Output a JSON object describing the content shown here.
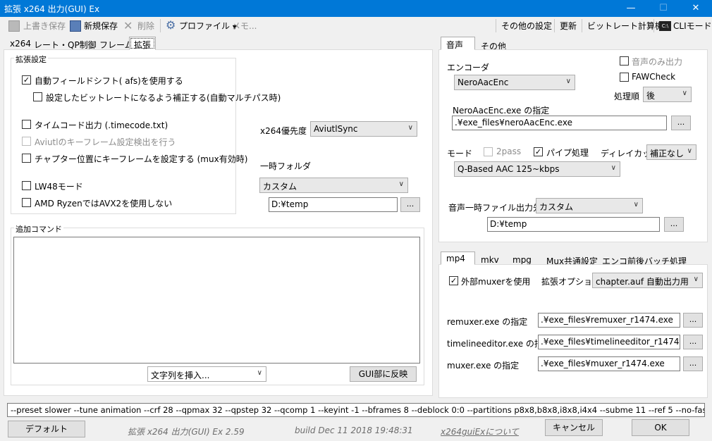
{
  "window": {
    "title": "拡張 x264 出力(GUI) Ex",
    "minimize": "—",
    "maximize": "☐",
    "close": "✕"
  },
  "toolbar": {
    "overwrite_save": "上書き保存",
    "new_save": "新規保存",
    "delete": "削除",
    "profile": "プロファイル",
    "memo": "メモ...",
    "other_settings": "その他の設定",
    "update": "更新",
    "bitrate_calc": "ビットレート計算機",
    "cli_mode": "CLIモード"
  },
  "left_tabs": [
    "x264",
    "レート・QP制御",
    "フレーム",
    "拡張"
  ],
  "ext": {
    "group_title": "拡張設定",
    "afs": "自動フィールドシフト( afs)を使用する",
    "afs_bitrate": "設定したビットレートになるよう補正する(自動マルチパス時)",
    "timecode": "タイムコード出力 (.timecode.txt)",
    "aviutl_keyframe": "Aviutlのキーフレーム設定検出を行う",
    "chapter_keyframe": "チャプター位置にキーフレームを設定する (mux有効時)",
    "lw48": "LW48モード",
    "amd_ryzen": "AMD RyzenではAVX2を使用しない",
    "priority_label": "x264優先度",
    "priority_value": "AviutlSync",
    "temp_label": "一時フォルダ",
    "temp_combo": "カスタム",
    "temp_path": "D:¥temp",
    "browse": "...",
    "extra_cmd_title": "追加コマンド",
    "insert_combo": "文字列を挿入...",
    "apply_button": "GUI部に反映"
  },
  "audio_tabs": [
    "音声",
    "その他"
  ],
  "audio": {
    "audio_only": "音声のみ出力",
    "fawcheck": "FAWCheck",
    "encoder_label": "エンコーダ",
    "encoder_value": "NeroAacEnc",
    "order_label": "処理順",
    "order_value": "後",
    "exe_label": "NeroAacEnc.exe の指定",
    "exe_path": ".¥exe_files¥neroAacEnc.exe",
    "mode_label": "モード",
    "twopass": "2pass",
    "pipe": "パイプ処理",
    "delay_label": "ディレイカット",
    "delay_value": "補正なし",
    "mode_value": "Q-Based AAC 125~kbps",
    "tmp_label": "音声一時ファイル出力先",
    "tmp_combo": "カスタム",
    "tmp_path": "D:¥temp",
    "browse": "..."
  },
  "mux_tabs": [
    "mp4",
    "mkv",
    "mpg",
    "Mux共通設定",
    "エンコ前後バッチ処理"
  ],
  "mux": {
    "use_external": "外部muxerを使用",
    "ext_option_label": "拡張オプション",
    "ext_option_value": "chapter.auf 自動出力用",
    "remuxer_label": "remuxer.exe の指定",
    "remuxer_path": ".¥exe_files¥remuxer_r1474.exe",
    "timelineeditor_label": "timelineeditor.exe の指定",
    "timelineeditor_path": ".¥exe_files¥timelineeditor_r1474.exe",
    "muxer_label": "muxer.exe の指定",
    "muxer_path": ".¥exe_files¥muxer_r1474.exe",
    "browse": "..."
  },
  "cmdline": "--preset slower --tune animation --crf 28 --qpmax 32 --qpstep 32 --qcomp 1 --keyint -1 --bframes 8 --deblock 0:0 --partitions p8x8,b8x8,i8x8,i4x4 --subme 11 --ref 5 --no-fast-",
  "footer": {
    "default_button": "デフォルト",
    "app_version": "拡張 x264 出力(GUI) Ex 2.59",
    "build": "build Dec 11 2018 19:48:31",
    "about_link": "x264guiExについて",
    "cancel_button": "キャンセル",
    "ok_button": "OK"
  },
  "check_mark": "✓",
  "icons": {
    "save": "save-icon",
    "new_save": "new-save-icon",
    "delete": "delete-icon",
    "profile": "gear-icon",
    "cli": "cli-icon"
  }
}
